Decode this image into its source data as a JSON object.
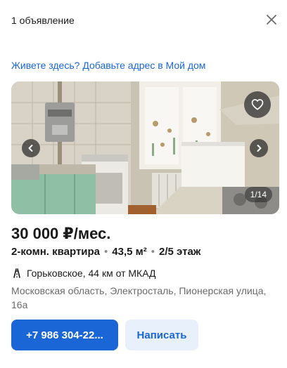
{
  "header": {
    "title": "1 объявление",
    "close_icon": "close-icon"
  },
  "address_link": "Живете здесь? Добавьте адрес в Мой дом",
  "gallery": {
    "counter": "1/14",
    "current_index": 1,
    "total": 14,
    "favorite_icon": "heart-outline-icon",
    "prev_icon": "chevron-left-icon",
    "next_icon": "chevron-right-icon"
  },
  "listing": {
    "price": "30 000 ₽/мес.",
    "rooms": "2-комн. квартира",
    "area": "43,5 м²",
    "floor": "2/5 этаж",
    "route_icon": "highway-icon",
    "route": "Горьковское, 44 км от МКАД",
    "location": "Московская область, Электросталь, Пионерская улица, 16а"
  },
  "actions": {
    "phone": "+7 986 304-22...",
    "write": "Написать"
  },
  "colors": {
    "accent": "#1a66d6",
    "accent_light": "#e8f0fc",
    "muted_text": "#6b6b6b"
  }
}
